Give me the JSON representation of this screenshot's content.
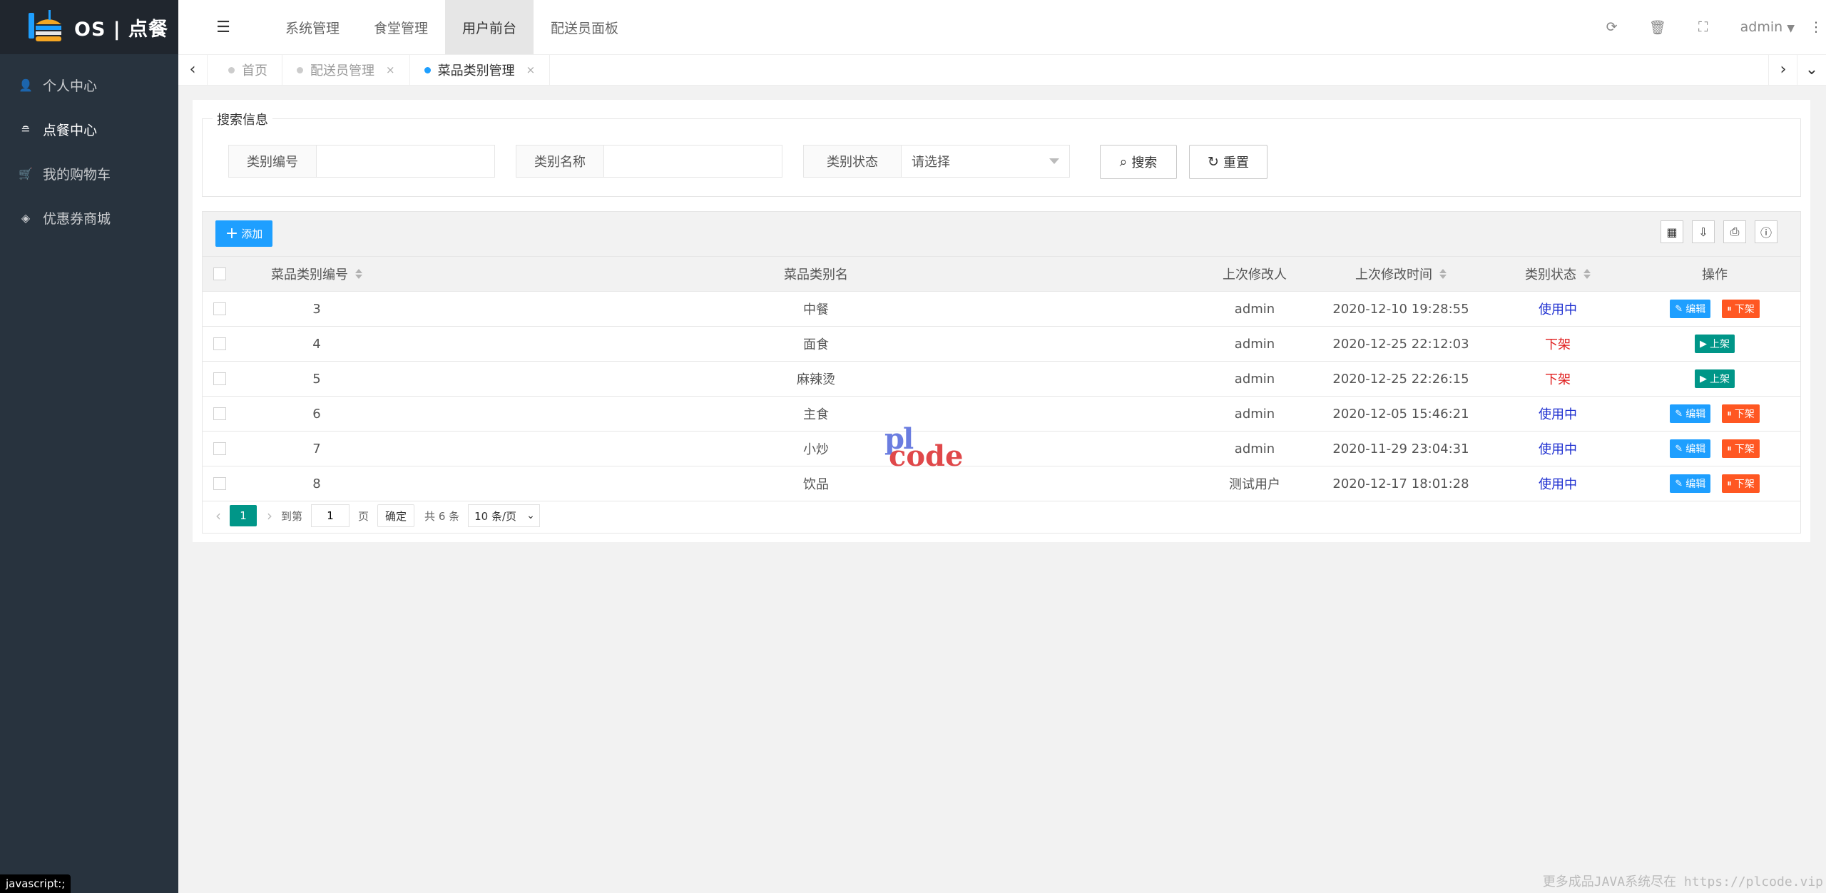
{
  "app": {
    "title": "OS | 点餐"
  },
  "sidebar": {
    "items": [
      {
        "label": "个人中心",
        "icon": "user-icon"
      },
      {
        "label": "点餐中心",
        "icon": "food-tray-icon"
      },
      {
        "label": "我的购物车",
        "icon": "cart-icon"
      },
      {
        "label": "优惠券商城",
        "icon": "tag-icon"
      }
    ],
    "active_index": 1
  },
  "header": {
    "nav": [
      "系统管理",
      "食堂管理",
      "用户前台",
      "配送员面板"
    ],
    "active_nav": "用户前台",
    "user": "admin"
  },
  "tabs": {
    "items": [
      {
        "label": "首页",
        "closable": false,
        "active": false
      },
      {
        "label": "配送员管理",
        "closable": true,
        "active": false
      },
      {
        "label": "菜品类别管理",
        "closable": true,
        "active": true
      }
    ],
    "close_glyph": "×"
  },
  "search": {
    "legend": "搜索信息",
    "fields": [
      {
        "label": "类别编号",
        "value": ""
      },
      {
        "label": "类别名称",
        "value": ""
      },
      {
        "label": "类别状态",
        "value": "请选择"
      }
    ],
    "search_label": "搜索",
    "reset_label": "重置"
  },
  "toolbar": {
    "add_label": "添加"
  },
  "table": {
    "columns": [
      "菜品类别编号",
      "菜品类别名",
      "上次修改人",
      "上次修改时间",
      "类别状态",
      "操作"
    ],
    "rows": [
      {
        "id": "3",
        "name": "中餐",
        "modifier": "admin",
        "time": "2020-12-10 19:28:55",
        "status": "使用中",
        "active": true
      },
      {
        "id": "4",
        "name": "面食",
        "modifier": "admin",
        "time": "2020-12-25 22:12:03",
        "status": "下架",
        "active": false
      },
      {
        "id": "5",
        "name": "麻辣烫",
        "modifier": "admin",
        "time": "2020-12-25 22:26:15",
        "status": "下架",
        "active": false
      },
      {
        "id": "6",
        "name": "主食",
        "modifier": "admin",
        "time": "2020-12-05 15:46:21",
        "status": "使用中",
        "active": true
      },
      {
        "id": "7",
        "name": "小炒",
        "modifier": "admin",
        "time": "2020-11-29 23:04:31",
        "status": "使用中",
        "active": true
      },
      {
        "id": "8",
        "name": "饮品",
        "modifier": "测试用户",
        "time": "2020-12-17 18:01:28",
        "status": "使用中",
        "active": true
      }
    ],
    "edit_label": "编辑",
    "off_label": "下架",
    "on_label": "上架"
  },
  "pager": {
    "current": "1",
    "goto_label": "到第",
    "goto_value": "1",
    "page_unit": "页",
    "confirm_label": "确定",
    "total_label": "共 6 条",
    "page_size": "10 条/页"
  },
  "status_tip": "javascript:;",
  "watermark": {
    "line1": "pl",
    "line2": "code"
  },
  "footer_note": "更多成品JAVA系统尽在 https://plcode.vip",
  "colors": {
    "sidebar": "#28333e",
    "logo_bg": "#20262e",
    "primary": "#1E9FFF",
    "danger": "#FF5722",
    "success": "#009688",
    "status_on": "#1E2FD0",
    "status_off": "#e02020"
  }
}
